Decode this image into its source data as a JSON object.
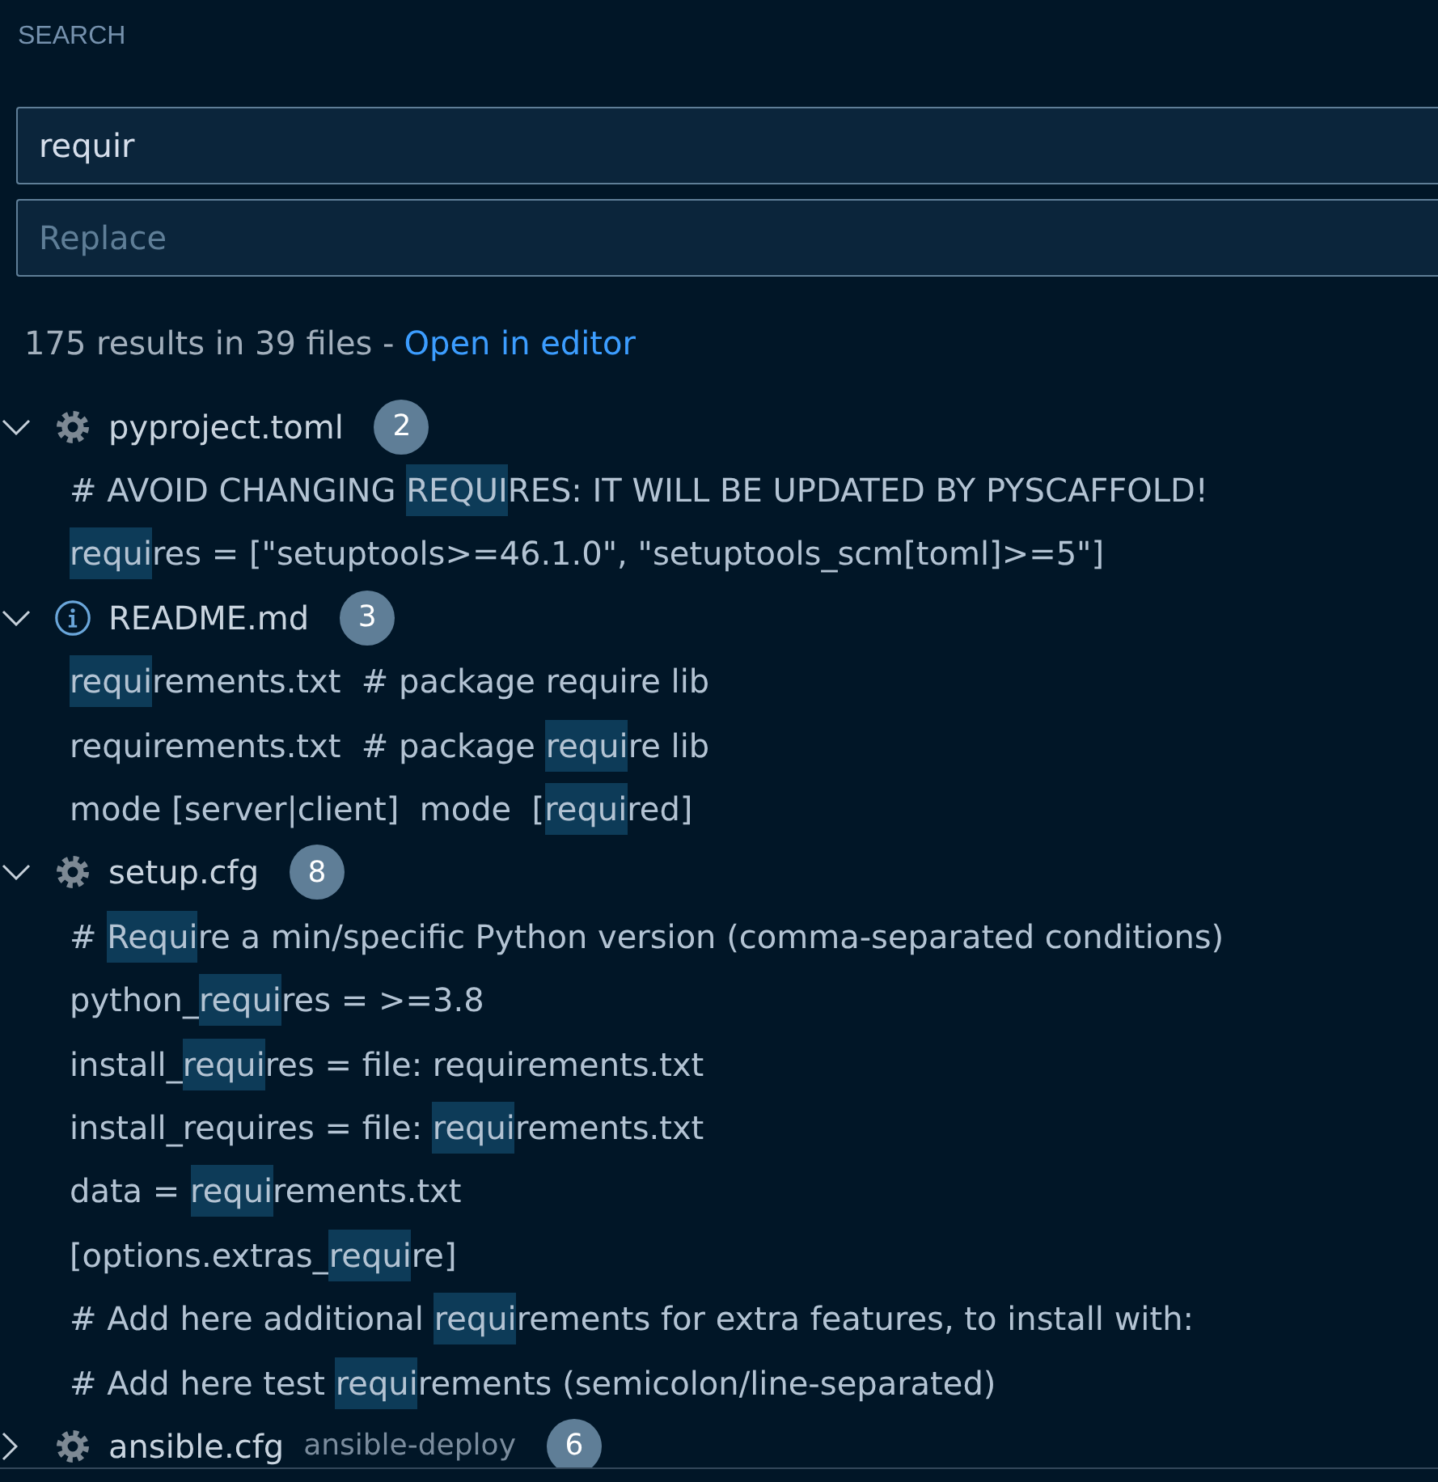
{
  "panel": {
    "title": "SEARCH"
  },
  "search": {
    "value": "requir"
  },
  "replace": {
    "placeholder": "Replace"
  },
  "summary": {
    "text": "175 results in 39 files -",
    "link": "Open in editor"
  },
  "results": [
    {
      "file": "pyproject.toml",
      "kind": "settings",
      "count": "2",
      "expanded": true,
      "matches": [
        {
          "before": "# AVOID CHANGING ",
          "match": "REQUI",
          "after": "RES: IT WILL BE UPDATED BY PYSCAFFOLD!"
        },
        {
          "match": "requi",
          "after": "res = [\"setuptools>=46.1.0\", \"setuptools_scm[toml]>=5\"]"
        }
      ]
    },
    {
      "file": "README.md",
      "kind": "info",
      "count": "3",
      "expanded": true,
      "matches": [
        {
          "match": "requi",
          "after": "rements.txt  # package require lib"
        },
        {
          "before": "requirements.txt  # package ",
          "match": "requi",
          "after": "re lib"
        },
        {
          "before": "mode [server|client]  mode  [",
          "match": "requi",
          "after": "red]"
        }
      ]
    },
    {
      "file": "setup.cfg",
      "kind": "settings",
      "count": "8",
      "expanded": true,
      "matches": [
        {
          "before": "# ",
          "match": "Requi",
          "after": "re a min/specific Python version (comma-separated conditions)"
        },
        {
          "before": "python_",
          "match": "requi",
          "after": "res = >=3.8"
        },
        {
          "before": "install_",
          "match": "requi",
          "after": "res = file: requirements.txt"
        },
        {
          "before": "install_requires = file: ",
          "match": "requi",
          "after": "rements.txt"
        },
        {
          "before": "data = ",
          "match": "requi",
          "after": "rements.txt"
        },
        {
          "before": "[options.extras_",
          "match": "requi",
          "after": "re]"
        },
        {
          "before": "# Add here additional ",
          "match": "requi",
          "after": "rements for extra features, to install with:"
        },
        {
          "before": "# Add here test ",
          "match": "requi",
          "after": "rements (semicolon/line-separated)"
        }
      ]
    },
    {
      "file": "ansible.cfg",
      "folder": "ansible-deploy",
      "kind": "settings",
      "count": "6",
      "expanded": false
    }
  ]
}
